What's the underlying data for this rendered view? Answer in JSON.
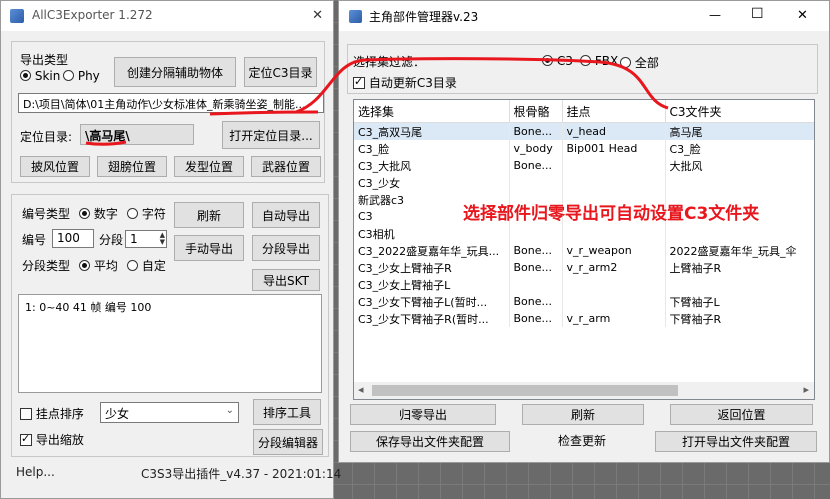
{
  "left": {
    "title": "AllC3Exporter 1.272",
    "close_glyph": "✕",
    "export_type_label": "导出类型",
    "radio_skin": "Skin",
    "radio_phy": "Phy",
    "create_helper_btn": "创建分隔辅助物体",
    "locate_c3_btn": "定位C3目录",
    "path_value": "D:\\项目\\简体\\01主角动作\\少女标准体_新乘骑坐姿_制能...",
    "locate_dir_label": "定位目录:",
    "locate_dir_value": "\\高马尾\\",
    "open_locate_btn": "打开定位目录...",
    "cape_btn": "披风位置",
    "wing_btn": "翅膀位置",
    "hair_btn": "发型位置",
    "weapon_btn": "武器位置",
    "num_type_label": "编号类型",
    "radio_number": "数字",
    "radio_char": "字符",
    "refresh_btn": "刷新",
    "auto_export_btn": "自动导出",
    "num_label": "编号",
    "num_value": "100",
    "segment_label": "分段",
    "segment_value": "1",
    "manual_export_btn": "手动导出",
    "seg_export_btn": "分段导出",
    "seg_type_label": "分段类型",
    "radio_avg": "平均",
    "radio_custom": "自定",
    "export_skt_btn": "导出SKT",
    "frames_text": "1: 0~40 41 帧 编号 100",
    "mount_sort_label": "挂点排序",
    "combo_value": "少女",
    "sort_tool_btn": "排序工具",
    "export_scale_label": "导出缩放",
    "seg_editor_btn": "分段编辑器",
    "help_text": "Help...",
    "version_text": "C3S3导出插件_v4.37  - 2021:01:14"
  },
  "right": {
    "title": "主角部件管理器v.23",
    "min_glyph": "—",
    "max_glyph": "☐",
    "close_glyph": "✕",
    "filter_label": "选择集过滤：",
    "filter_options": [
      "C3",
      "FBX",
      "全部"
    ],
    "auto_update_label": "自动更新C3目录",
    "columns": [
      "选择集",
      "根骨骼",
      "挂点",
      "C3文件夹"
    ],
    "rows": [
      [
        "C3_高双马尾",
        "Bone...",
        "v_head",
        "高马尾"
      ],
      [
        "C3_脸",
        "v_body",
        "Bip001 Head",
        "C3_脸"
      ],
      [
        "C3_大批风",
        "Bone...",
        "",
        "大批风"
      ],
      [
        "C3_少女",
        "",
        "",
        ""
      ],
      [
        "新武器c3",
        "",
        "",
        ""
      ],
      [
        "C3",
        "",
        "",
        ""
      ],
      [
        "C3相机",
        "",
        "",
        ""
      ],
      [
        "C3_2022盛夏嘉年华_玩具...",
        "Bone...",
        "v_r_weapon",
        "2022盛夏嘉年华_玩具_伞"
      ],
      [
        "C3_少女上臂袖子R",
        "Bone...",
        "v_r_arm2",
        "上臂袖子R"
      ],
      [
        "C3_少女上臂袖子L",
        "",
        "",
        ""
      ],
      [
        "C3_少女下臂袖子L(暂时...",
        "Bone...",
        "",
        "下臂袖子L"
      ],
      [
        "C3_少女下臂袖子R(暂时...",
        "Bone...",
        "v_r_arm",
        "下臂袖子R"
      ]
    ],
    "annotation": "选择部件归零导出可自动设置C3文件夹",
    "zero_export_btn": "归零导出",
    "refresh_btn": "刷新",
    "return_pos_btn": "返回位置",
    "save_config_btn": "保存导出文件夹配置",
    "check_update_label": "检查更新",
    "open_export_btn": "打开导出文件夹配置",
    "scroll_left": "◂",
    "scroll_right": "▸"
  },
  "colors": {
    "annotation_red": "#e8161d",
    "selected_row": "#dbe8f6"
  }
}
